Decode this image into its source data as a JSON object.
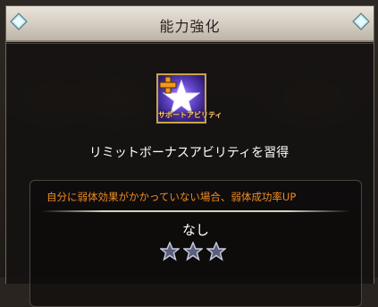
{
  "header": {
    "title": "能力強化"
  },
  "ability": {
    "icon_name": "support-ability-star-icon",
    "icon_label": "サポートアビリティ",
    "title": "リミットボーナスアビリティを習得"
  },
  "panel": {
    "effect": "自分に弱体効果がかかっていない場合、弱体成功率UP",
    "level_text": "なし",
    "stars_filled": 0,
    "stars_total": 3
  },
  "colors": {
    "effect_text": "#f08c22",
    "icon_border": "#c8a548",
    "header_bg": "#d4ccc1"
  }
}
